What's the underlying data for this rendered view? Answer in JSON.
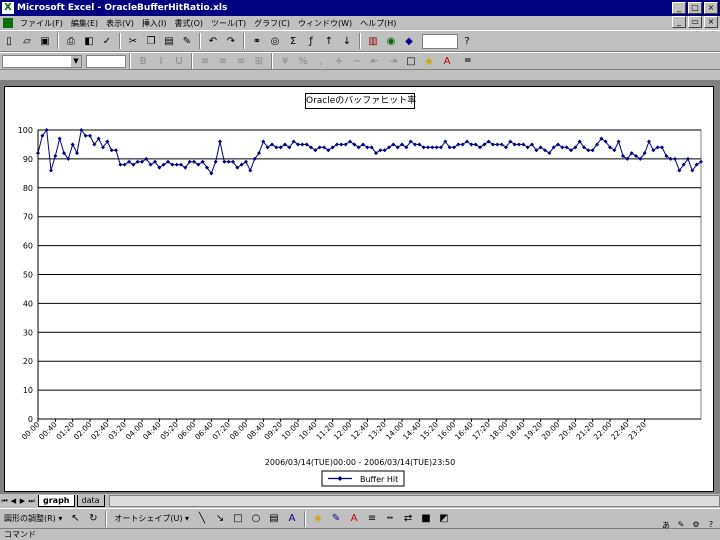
{
  "window": {
    "title": "Microsoft Excel - OracleBufferHitRatio.xls",
    "app_icon_glyph": "X",
    "controls": [
      "_",
      "□",
      "×"
    ]
  },
  "menu": {
    "items": [
      "ファイル(F)",
      "編集(E)",
      "表示(V)",
      "挿入(I)",
      "書式(O)",
      "ツール(T)",
      "グラフ(C)",
      "ウィンドウ(W)",
      "ヘルプ(H)"
    ],
    "doc_controls": [
      "_",
      "▭",
      "×"
    ]
  },
  "toolbar": {
    "standard_icons": [
      "new-icon",
      "open-icon",
      "save-icon",
      "print-icon",
      "print-preview-icon",
      "spell-check-icon",
      "cut-icon",
      "copy-icon",
      "paste-icon",
      "format-painter-icon",
      "undo-icon",
      "redo-icon",
      "hyperlink-icon",
      "web-icon",
      "autosum-icon",
      "function-icon",
      "sort-asc-icon",
      "sort-desc-icon",
      "chart-wizard-icon",
      "map-icon",
      "drawing-icon",
      "help-icon"
    ],
    "formatting_icons": [
      "bold-icon",
      "italic-icon",
      "underline-icon",
      "align-left-icon",
      "align-center-icon",
      "align-right-icon",
      "merge-icon",
      "currency-icon",
      "percent-icon",
      "comma-icon",
      "increase-decimal-icon",
      "decrease-decimal-icon",
      "decrease-indent-icon",
      "increase-indent-icon",
      "borders-icon",
      "fill-color-icon",
      "font-color-icon"
    ],
    "formula_equals": "="
  },
  "sheet_tabs": {
    "tabs": [
      "graph",
      "data"
    ],
    "active": "graph"
  },
  "drawing_toolbar": {
    "draw_label": "図形の調整(R) ▾",
    "autoshape_label": "オートシェイプ(U) ▾"
  },
  "status": {
    "text": "コマンド"
  },
  "chart_data": {
    "type": "line",
    "title": "Oracleのバッファヒット率",
    "xlabel": "2006/03/14(TUE)00:00 - 2006/03/14(TUE)23:50",
    "ylabel": "",
    "ylim": [
      0,
      100
    ],
    "yticks": [
      0,
      10,
      20,
      30,
      40,
      50,
      60,
      70,
      80,
      90,
      100
    ],
    "grid": true,
    "legend": "bottom-center",
    "x_tick_labels": [
      "00:00",
      "00:40",
      "01:20",
      "02:00",
      "02:40",
      "03:20",
      "04:00",
      "04:40",
      "05:20",
      "06:00",
      "06:40",
      "07:20",
      "08:00",
      "08:40",
      "09:20",
      "10:00",
      "10:40",
      "11:20",
      "12:00",
      "12:40",
      "13:20",
      "14:00",
      "14:40",
      "15:20",
      "16:00",
      "16:40",
      "17:20",
      "18:00",
      "18:40",
      "19:20",
      "20:00",
      "20:40",
      "21:20",
      "22:00",
      "22:40",
      "23:20"
    ],
    "series": [
      {
        "name": "Buffer Hit",
        "color": "#000080",
        "values": [
          92,
          98,
          100,
          86,
          91,
          97,
          92,
          90,
          95,
          92,
          100,
          98,
          98,
          95,
          97,
          94,
          96,
          93,
          93,
          88,
          88,
          89,
          88,
          89,
          89,
          90,
          88,
          89,
          87,
          88,
          89,
          88,
          88,
          88,
          87,
          89,
          89,
          88,
          89,
          87,
          85,
          89,
          96,
          89,
          89,
          89,
          87,
          88,
          89,
          86,
          90,
          92,
          96,
          94,
          95,
          94,
          94,
          95,
          94,
          96,
          95,
          95,
          95,
          94,
          93,
          94,
          94,
          93,
          94,
          95,
          95,
          95,
          96,
          95,
          94,
          95,
          94,
          94,
          92,
          93,
          93,
          94,
          95,
          94,
          95,
          94,
          96,
          95,
          95,
          94,
          94,
          94,
          94,
          94,
          96,
          94,
          94,
          95,
          95,
          96,
          95,
          95,
          94,
          95,
          96,
          95,
          95,
          95,
          94,
          96,
          95,
          95,
          95,
          94,
          95,
          93,
          94,
          93,
          92,
          94,
          95,
          94,
          94,
          93,
          94,
          96,
          94,
          93,
          93,
          95,
          97,
          96,
          94,
          93,
          96,
          91,
          90,
          92,
          91,
          90,
          92,
          96,
          93,
          94,
          94,
          91,
          90,
          90,
          86,
          88,
          90,
          86,
          88,
          89
        ]
      }
    ]
  }
}
